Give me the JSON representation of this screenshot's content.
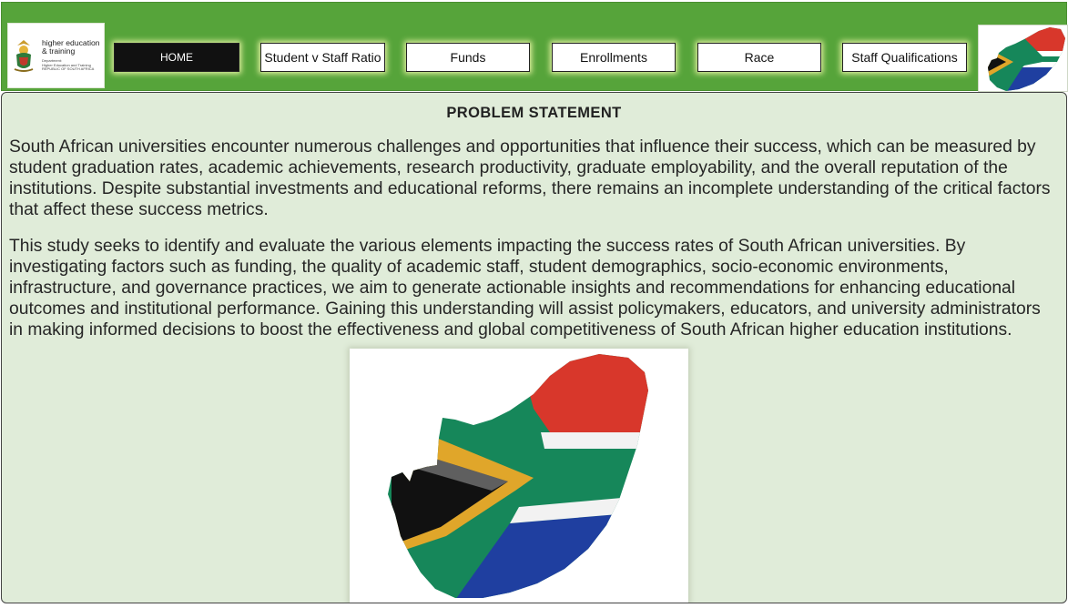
{
  "logo": {
    "title": "higher education\n& training",
    "subtitle": "Department:\nHigher Education and Training\nREPUBLIC OF SOUTH AFRICA"
  },
  "nav": [
    {
      "label": "HOME",
      "active": true
    },
    {
      "label": "Student v Staff Ratio",
      "active": false
    },
    {
      "label": "Funds",
      "active": false
    },
    {
      "label": "Enrollments",
      "active": false
    },
    {
      "label": "Race",
      "active": false
    },
    {
      "label": "Staff Qualifications",
      "active": false
    }
  ],
  "main": {
    "heading": "PROBLEM STATEMENT",
    "paragraphs": [
      "South African universities encounter numerous challenges and opportunities that influence their success, which can be measured by student graduation rates, academic achievements, research productivity, graduate employability, and the overall reputation of the institutions. Despite substantial investments and educational reforms, there remains an incomplete understanding of the critical factors that affect these success metrics.",
      "This study seeks to identify and evaluate the various elements impacting the success rates of South African universities. By investigating factors such as funding, the quality of academic staff, student demographics, socio-economic environments, infrastructure, and governance practices, we aim to generate actionable insights and recommendations for enhancing educational outcomes and institutional performance. Gaining this understanding will assist policymakers, educators, and university administrators in making informed decisions to boost the effectiveness and global competitiveness of South African higher education institutions."
    ]
  },
  "colors": {
    "header_green": "#56a43a",
    "content_bg": "#e0ecd9",
    "flag_red": "#d8372b",
    "flag_green": "#16875a",
    "flag_blue": "#1f3fa0",
    "flag_gold": "#e0a62a",
    "flag_black": "#111111"
  },
  "icons": {
    "logo_emblem": "coat-of-arms-icon",
    "header_flag": "south-africa-flag-map-icon",
    "main_image": "south-africa-flag-map-image"
  }
}
